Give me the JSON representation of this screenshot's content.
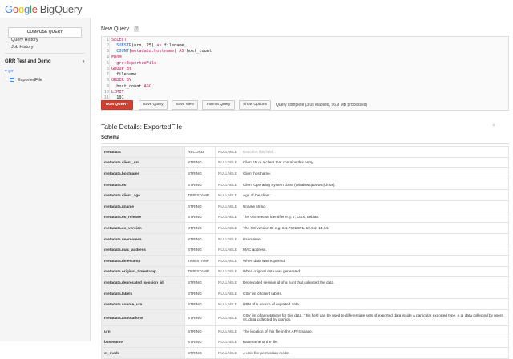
{
  "app": {
    "brand_google": "Google",
    "brand_product": "BigQuery"
  },
  "sidebar": {
    "compose_label": "COMPOSE QUERY",
    "links": [
      "Query History",
      "Job History"
    ],
    "project_name": "GRR Test and Demo",
    "dataset": "grr",
    "table": "ExportedFile"
  },
  "editor": {
    "title": "New Query",
    "help": "?",
    "lines": [
      {
        "n": "1",
        "code": "SELECT"
      },
      {
        "n": "2",
        "code": "  SUBSTR(urn, 25) as filename,"
      },
      {
        "n": "3",
        "code": "  COUNT(metadata.hostname) AS host_count"
      },
      {
        "n": "4",
        "code": "FROM"
      },
      {
        "n": "5",
        "code": "  grr:ExportedFile"
      },
      {
        "n": "6",
        "code": "GROUP BY"
      },
      {
        "n": "7",
        "code": "  filename"
      },
      {
        "n": "8",
        "code": "ORDER BY"
      },
      {
        "n": "9",
        "code": "  host_count ASC"
      },
      {
        "n": "10",
        "code": "LIMIT"
      },
      {
        "n": "11",
        "code": "  101"
      }
    ]
  },
  "toolbar": {
    "run": "RUN QUERY",
    "save_query": "Save Query",
    "save_view": "Save View",
    "format_query": "Format Query",
    "show_options": "Show Options",
    "status": "Query complete (3.0s elapsed, 96.9 MB processed)"
  },
  "table_details": {
    "title": "Table Details: ExportedFile",
    "schema_label": "Schema",
    "rows": [
      {
        "name": "metadata",
        "type": "RECORD",
        "mode": "NULLABLE",
        "desc": "Describe this field...",
        "muted": true
      },
      {
        "name": "metadata.client_urn",
        "type": "STRING",
        "mode": "NULLABLE",
        "desc": "Client ID of a client that contains this entry."
      },
      {
        "name": "metadata.hostname",
        "type": "STRING",
        "mode": "NULLABLE",
        "desc": "Client hostname."
      },
      {
        "name": "metadata.os",
        "type": "STRING",
        "mode": "NULLABLE",
        "desc": "Client Operating System class (Windows|Darwin|Linux)."
      },
      {
        "name": "metadata.client_age",
        "type": "TIMESTAMP",
        "mode": "NULLABLE",
        "desc": "Age of the client."
      },
      {
        "name": "metadata.uname",
        "type": "STRING",
        "mode": "NULLABLE",
        "desc": "Uname string."
      },
      {
        "name": "metadata.os_release",
        "type": "STRING",
        "mode": "NULLABLE",
        "desc": "The OS release identifier e.g. 7, OSX, debian."
      },
      {
        "name": "metadata.os_version",
        "type": "STRING",
        "mode": "NULLABLE",
        "desc": "The OS version ID e.g. 6.1.7601SP1, 10.9.2, 14.04."
      },
      {
        "name": "metadata.usernames",
        "type": "STRING",
        "mode": "NULLABLE",
        "desc": "Username."
      },
      {
        "name": "metadata.mac_address",
        "type": "STRING",
        "mode": "NULLABLE",
        "desc": "MAC address."
      },
      {
        "name": "metadata.timestamp",
        "type": "TIMESTAMP",
        "mode": "NULLABLE",
        "desc": "When data was exported."
      },
      {
        "name": "metadata.original_timestamp",
        "type": "TIMESTAMP",
        "mode": "NULLABLE",
        "desc": "When original data was generated."
      },
      {
        "name": "metadata.deprecated_session_id",
        "type": "STRING",
        "mode": "NULLABLE",
        "desc": "Deprecated session id of a hunt that collected the data."
      },
      {
        "name": "metadata.labels",
        "type": "STRING",
        "mode": "NULLABLE",
        "desc": "CSV list of client labels."
      },
      {
        "name": "metadata.source_urn",
        "type": "STRING",
        "mode": "NULLABLE",
        "desc": "URN of a source of exported data."
      },
      {
        "name": "metadata.annotations",
        "type": "STRING",
        "mode": "NULLABLE",
        "desc": "CSV list of annotations for this data. This field can be used to differentiate sets of exported data inside a particular exported type. e.g. data collected by users vs. data collected by cronjob.",
        "tall": true
      },
      {
        "name": "urn",
        "type": "STRING",
        "mode": "NULLABLE",
        "desc": "The location of this file in the AFF4 space."
      },
      {
        "name": "basename",
        "type": "STRING",
        "mode": "NULLABLE",
        "desc": "Basename of the file."
      },
      {
        "name": "st_mode",
        "type": "STRING",
        "mode": "NULLABLE",
        "desc": "A unix file permission mode."
      }
    ]
  }
}
